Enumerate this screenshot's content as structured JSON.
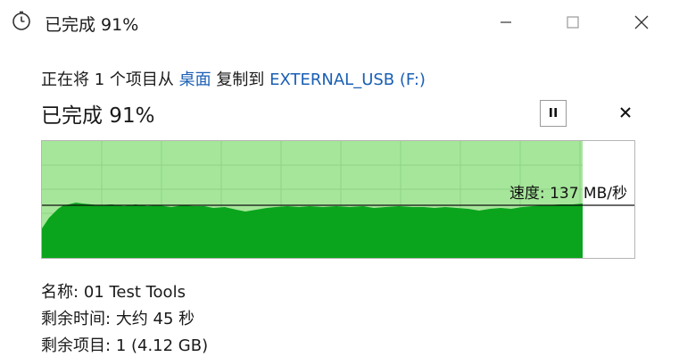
{
  "window": {
    "title": "已完成 91%"
  },
  "operation": {
    "prefix": "正在将",
    "count": "1",
    "unit": "个项目从",
    "source": "桌面",
    "verb": "复制到",
    "destination": "EXTERNAL_USB (F:)"
  },
  "status": {
    "text": "已完成 91%",
    "progress_percent": 91
  },
  "speed": {
    "label": "速度:",
    "value": "137 MB/秒"
  },
  "details": {
    "name_label": "名称:",
    "name_value": "01 Test Tools",
    "time_label": "剩余时间:",
    "time_value": "大约 45 秒",
    "items_label": "剩余项目:",
    "items_value": "1 (4.12 GB)"
  },
  "colors": {
    "progress_fill": "#a6e69a",
    "speed_fill": "#0aa51c",
    "link": "#1a5fb4"
  },
  "icons": {
    "app": "stopwatch-icon",
    "minimize": "minimize-icon",
    "maximize": "maximize-icon",
    "close": "close-icon",
    "pause": "pause-icon",
    "cancel": "cancel-icon"
  }
}
